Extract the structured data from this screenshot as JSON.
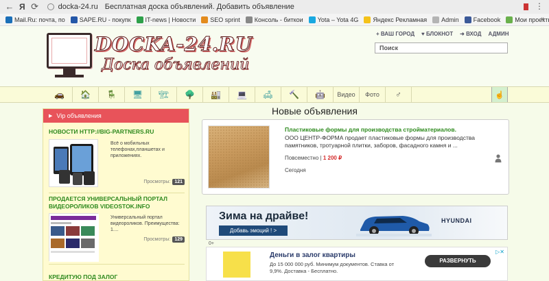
{
  "browser": {
    "brand": "Я",
    "url": "docka-24.ru",
    "title": "Бесплатная доска объявлений. Добавить объявление",
    "bookmarks": [
      {
        "label": "Mail.Ru: почта, по",
        "color": "#1b6fb8"
      },
      {
        "label": "SAPE.RU - покупк",
        "color": "#2457a8"
      },
      {
        "label": "IT-news | Новости",
        "color": "#2ea04a"
      },
      {
        "label": "SEO sprint",
        "color": "#e38b1e"
      },
      {
        "label": "Консоль - биткои",
        "color": "#888888"
      },
      {
        "label": "Yota – Yota 4G",
        "color": "#19a8e0"
      },
      {
        "label": "Яндекс Рекламная",
        "color": "#f4c21a"
      },
      {
        "label": "Admin",
        "color": "#b4b4b4"
      },
      {
        "label": "Facebook",
        "color": "#3b5998"
      },
      {
        "label": "Мои проекты",
        "color": "#6ab04c"
      }
    ]
  },
  "header": {
    "logo_text": "DOCKA-24.RU",
    "logo_sub": "Доска объявлений",
    "links": [
      "+ ВАШ ГОРОД",
      "♥ БЛОКНОТ",
      "➜ ВХОД",
      "АДМИН"
    ],
    "search_placeholder": "Поиск"
  },
  "categories": {
    "icons": [
      "car-icon",
      "house-icon",
      "chair-icon",
      "desk-icon",
      "worker-icon",
      "tree-icon",
      "factory-icon",
      "monitor-icon",
      "sofa-icon",
      "hammer-icon",
      "robot-icon"
    ],
    "text_tabs": [
      "Видео",
      "Фото"
    ],
    "person": "person-icon",
    "last": "hand-icon"
  },
  "vip": {
    "heading": "Vip объявления",
    "items": [
      {
        "title": "НОВОСТИ HTTP://BIG-PARTNERS.RU",
        "desc": "Всё о мобильных телефонах,планшетах и приложениях.",
        "views_label": "Просмотры:",
        "views": "121"
      },
      {
        "title": "ПРОДАЕТСЯ УНИВЕРСАЛЬНЫЙ ПОРТАЛ ВИДЕОРОЛИКОВ VIDEOSTOK.INFO",
        "desc": "Универсальный портал видеороликов. Преимущества: 1....",
        "views_label": "Просмотры:",
        "views": "129"
      },
      {
        "title": "КРЕДИТУЮ ПОД ЗАЛОГ"
      }
    ]
  },
  "main": {
    "title": "Новые объявления",
    "listing": {
      "title": "Пластиковые формы для производства стройматериалов.",
      "desc": "ООО ЦЕНТР-ФОРМА продает пластиковые формы для производства памятников, тротуарной плитки, заборов, фасадного камня и ...",
      "location": "Повсеместно",
      "sep": "|",
      "price": "1 200 ₽",
      "date": "Сегодня"
    }
  },
  "ads": {
    "ad1": {
      "title": "Зима на драйве!",
      "button": "Добавь эмоций ! >",
      "brand": "HYUNDAI",
      "age": "0+"
    },
    "ad2": {
      "title": "Деньги в залог квартиры",
      "desc": "До 15 000 000 руб. Минимум документов. Ставка от 9,9%. Доставка - Бесплатно.",
      "button": "РАЗВЕРНУТЬ",
      "mark": "▷✕"
    }
  }
}
